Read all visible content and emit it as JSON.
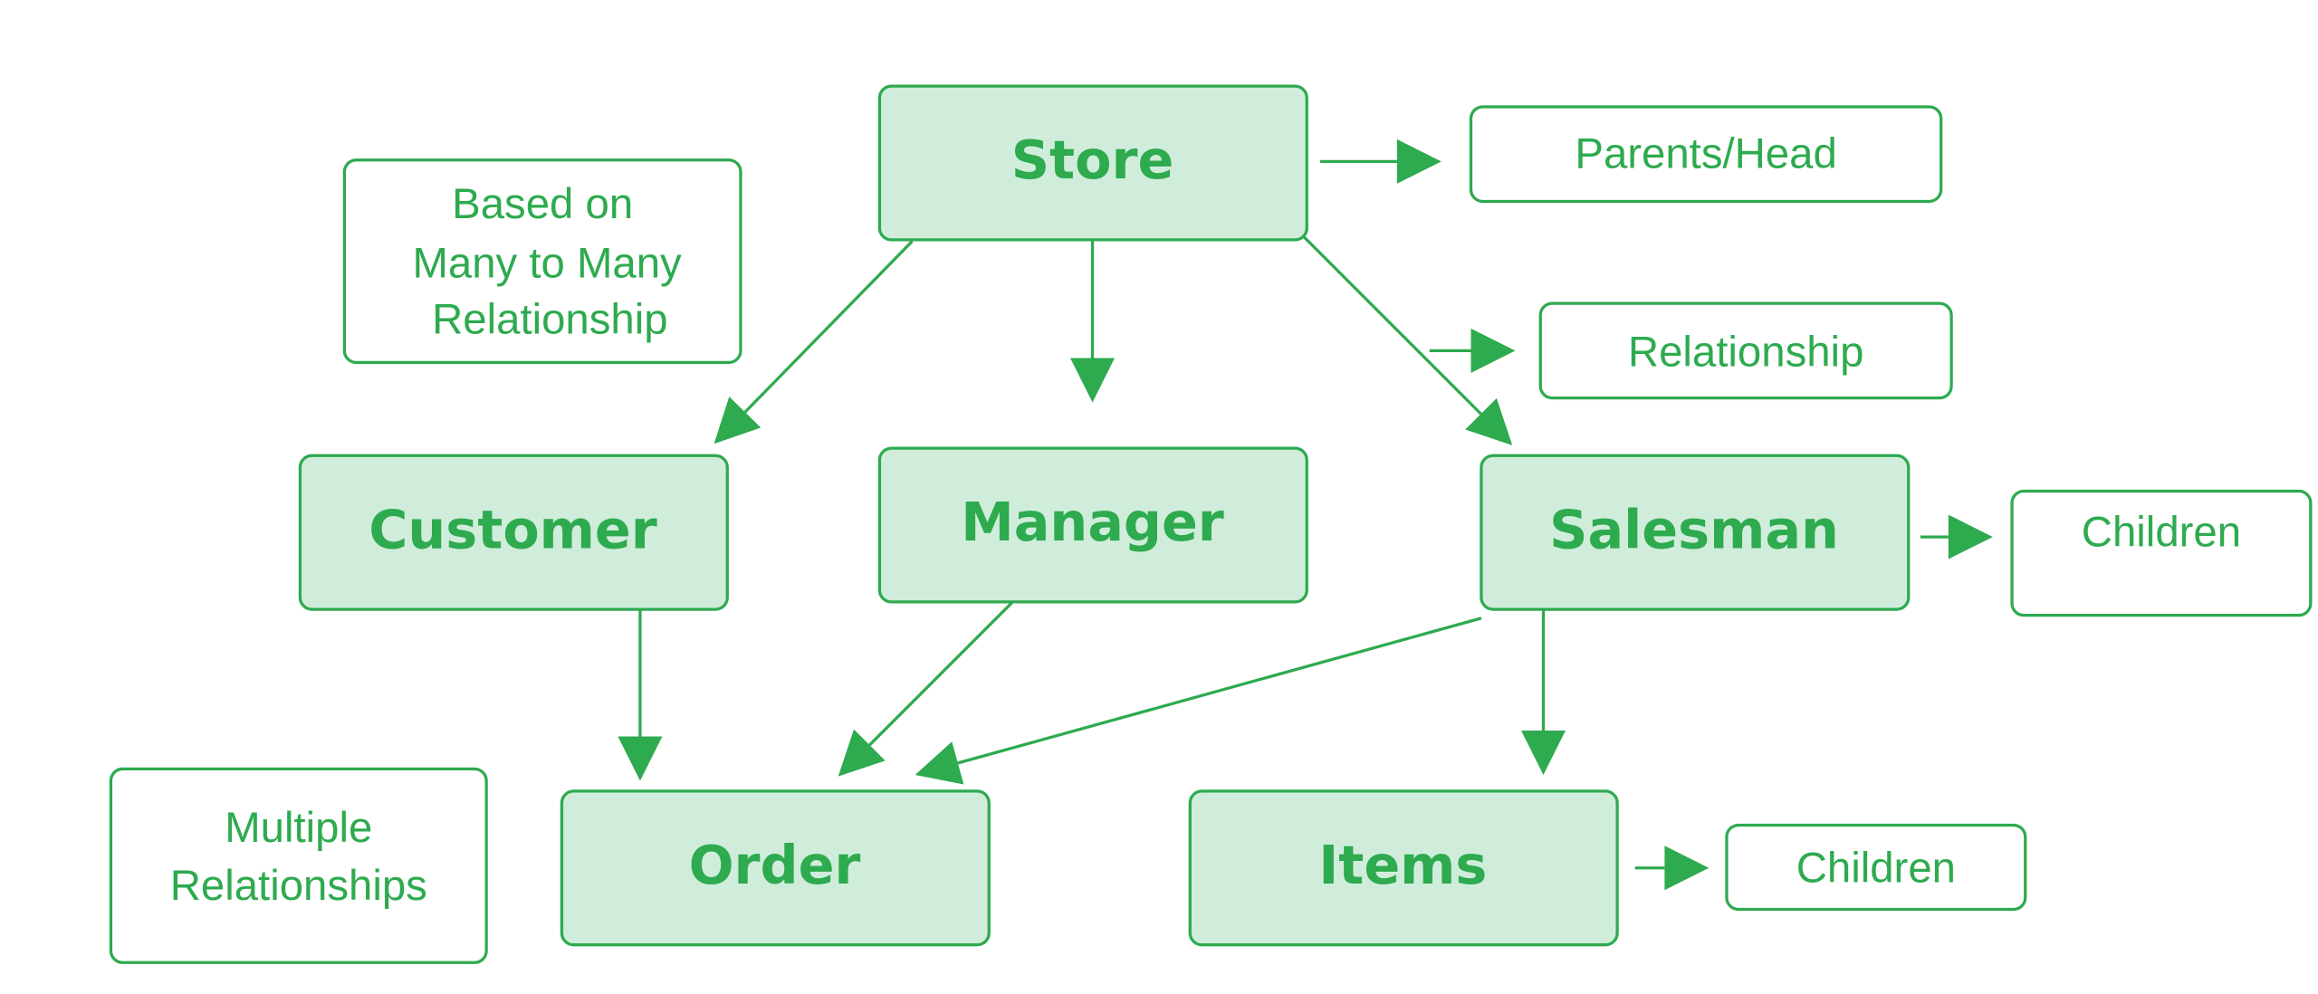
{
  "colors": {
    "accent": "#2eaa4f",
    "node_fill": "#d0eddb"
  },
  "nodes": {
    "store": "Store",
    "customer": "Customer",
    "manager": "Manager",
    "salesman": "Salesman",
    "order": "Order",
    "items": "Items"
  },
  "notes": {
    "many_to_many": [
      "Based on",
      "Many to Many",
      "Relationship"
    ],
    "multiple": [
      "Multiple",
      "Relationships"
    ],
    "parents": "Parents/Head",
    "relationship": "Relationship",
    "children_salesman": "Children",
    "children_items": "Children"
  }
}
